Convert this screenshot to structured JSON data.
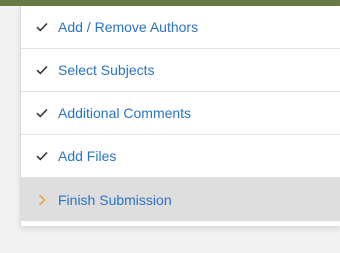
{
  "steps": [
    {
      "label": "Add / Remove Authors",
      "status": "complete",
      "icon": "check-icon"
    },
    {
      "label": "Select Subjects",
      "status": "complete",
      "icon": "check-icon"
    },
    {
      "label": "Additional Comments",
      "status": "complete",
      "icon": "check-icon"
    },
    {
      "label": "Add Files",
      "status": "complete",
      "icon": "check-icon"
    },
    {
      "label": "Finish Submission",
      "status": "current",
      "icon": "chevron-right-icon"
    }
  ],
  "colors": {
    "link": "#2a73c4",
    "check": "#333333",
    "current_arrow": "#f0a04a",
    "current_bg": "#dedede",
    "header_bar": "#6a7a44"
  }
}
